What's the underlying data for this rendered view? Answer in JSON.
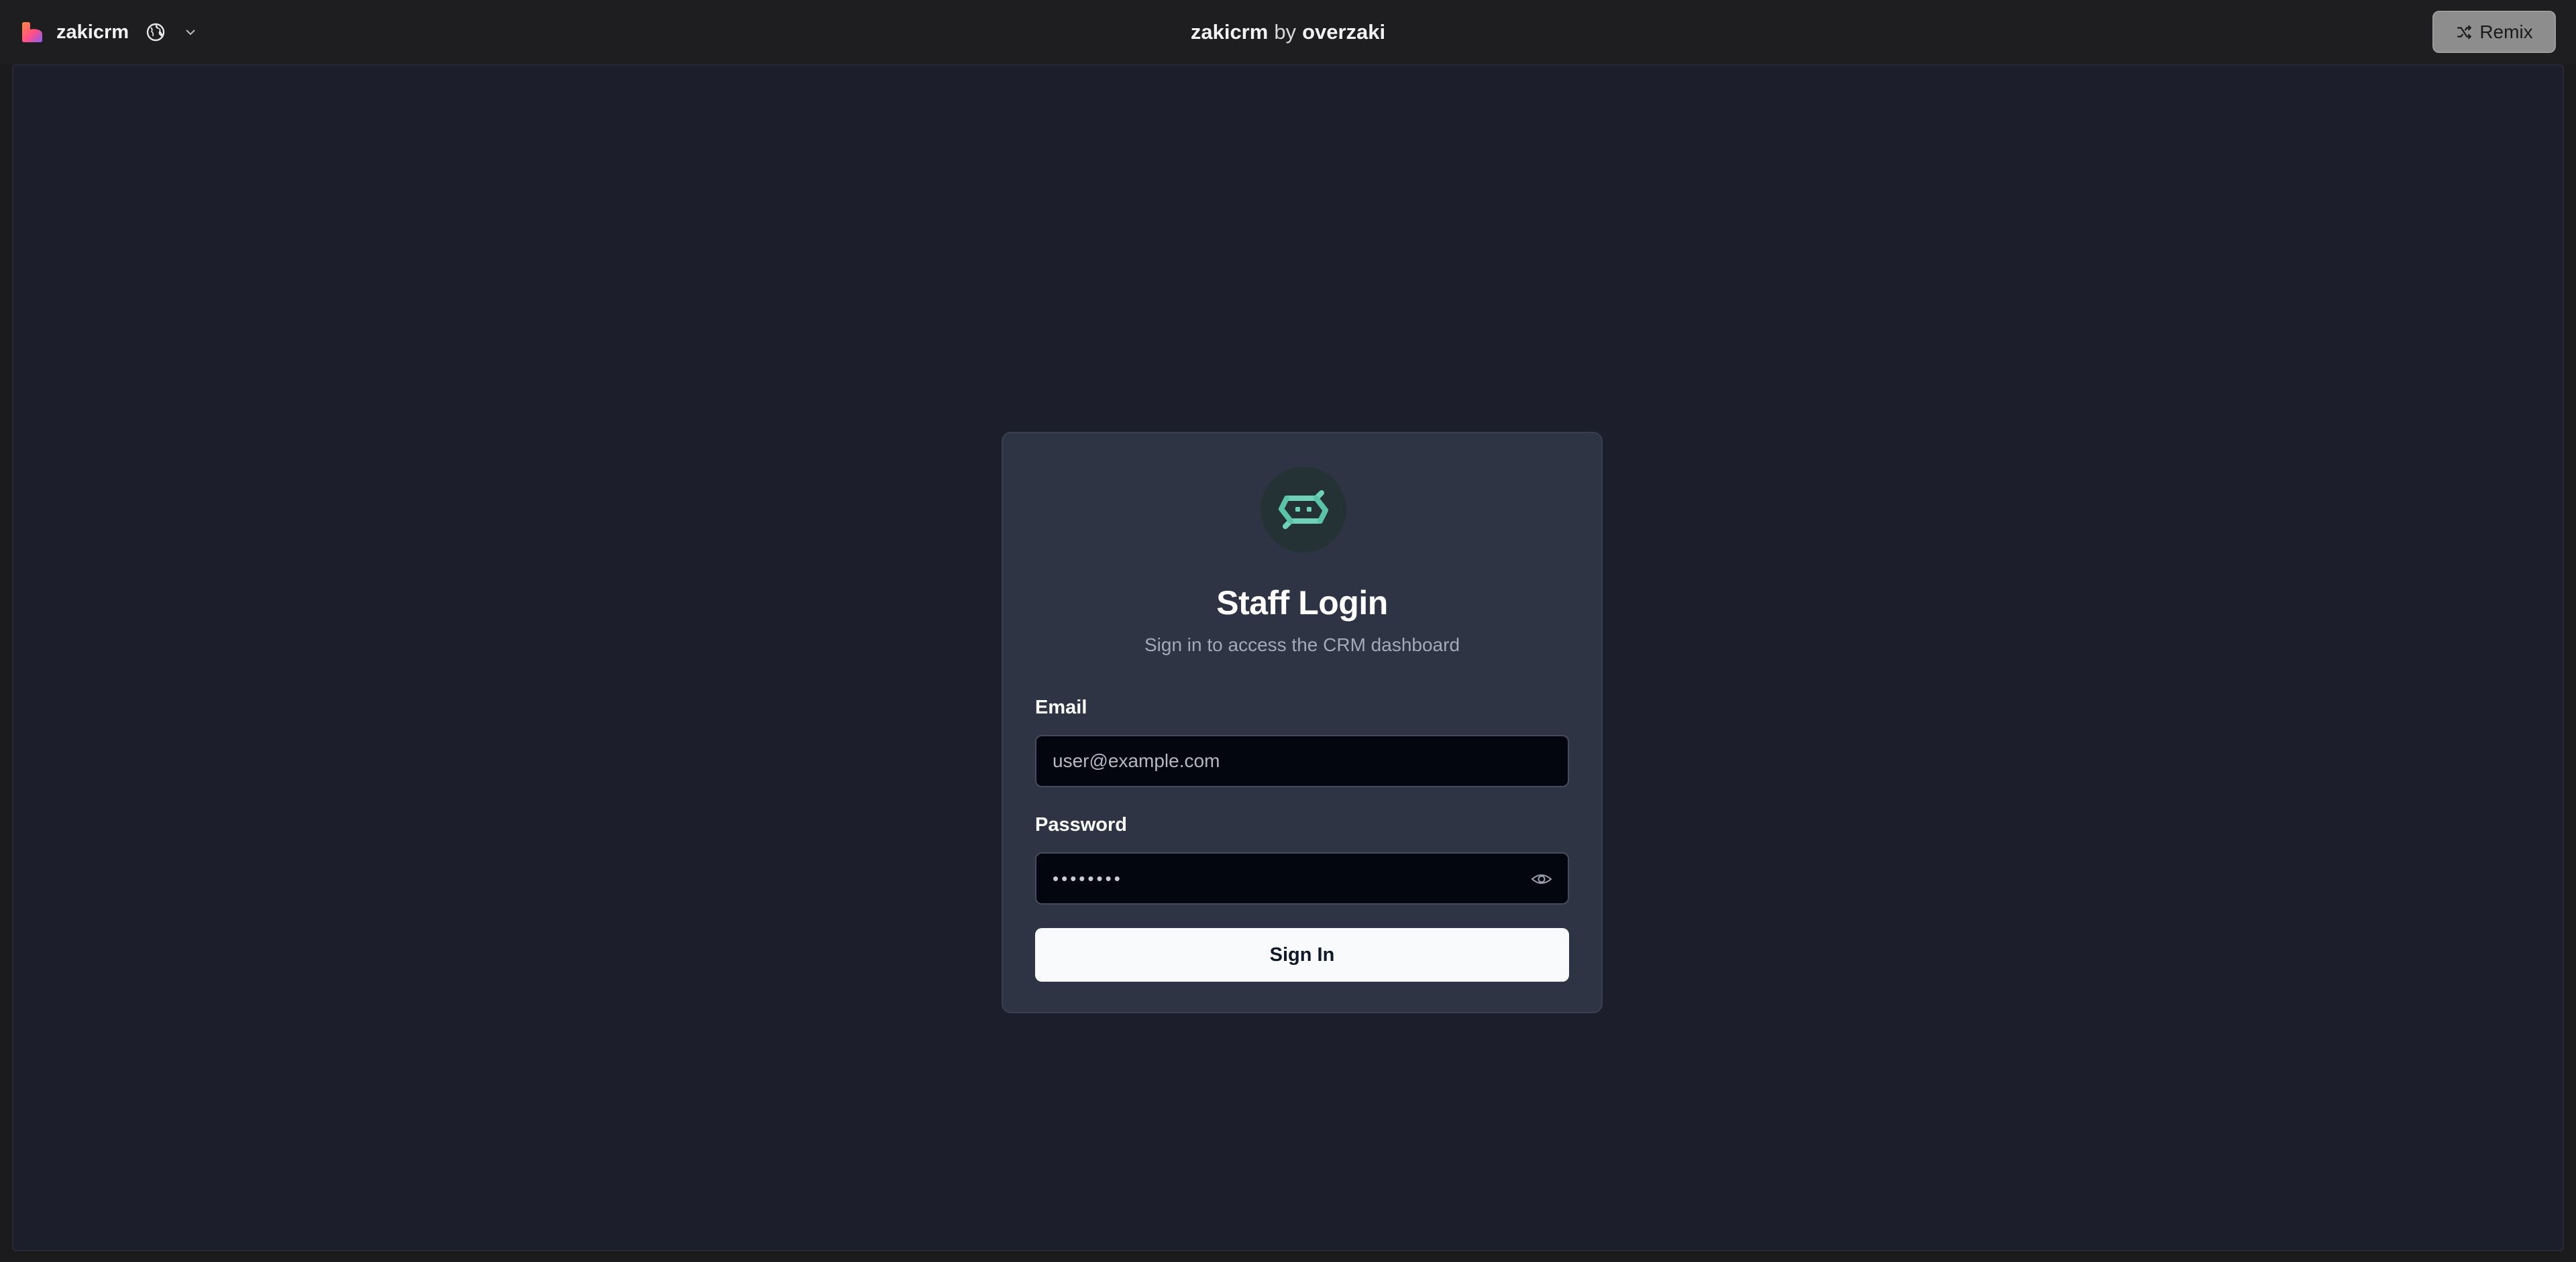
{
  "topbar": {
    "app_name": "zakicrm",
    "title_project": "zakicrm",
    "title_by": "by",
    "title_owner": "overzaki",
    "remix_label": "Remix"
  },
  "login": {
    "title": "Staff Login",
    "subtitle": "Sign in to access the CRM dashboard",
    "email_label": "Email",
    "email_placeholder": "user@example.com",
    "password_label": "Password",
    "password_value": "••••••••",
    "signin_label": "Sign In"
  },
  "colors": {
    "frame_bg": "#1c1f2b",
    "card_bg": "#2f3444",
    "input_bg": "#03060f",
    "logo_teal": "#6fd1b5",
    "button_bg": "#f8fafc"
  },
  "icons": [
    "brand-logo-icon",
    "globe-icon",
    "chevron-down-icon",
    "shuffle-icon",
    "zaki-logo-icon",
    "eye-icon"
  ]
}
